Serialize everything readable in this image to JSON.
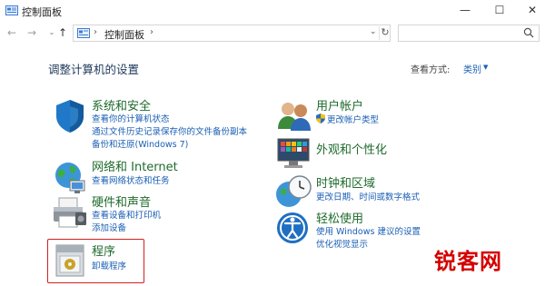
{
  "window": {
    "title": "控制面板",
    "minimize_glyph": "—",
    "maximize_glyph": "☐",
    "close_glyph": "✕"
  },
  "nav": {
    "back_icon": "arrow-left-icon",
    "forward_icon": "arrow-right-icon",
    "up_icon": "arrow-up-icon",
    "address_sep": "›",
    "address_text": "控制面板",
    "address_sep2": "›",
    "refresh_glyph": "↻",
    "dropdown_glyph": "⌄",
    "search_placeholder": ""
  },
  "main": {
    "heading": "调整计算机的设置",
    "view_by_label": "查看方式:",
    "view_by_value": "类别",
    "view_by_arrow": "▼"
  },
  "categories_left": [
    {
      "title": "系统和安全",
      "links": [
        "查看你的计算机状态",
        "通过文件历史记录保存你的文件备份副本",
        "备份和还原(Windows 7)"
      ]
    },
    {
      "title": "网络和 Internet",
      "links": [
        "查看网络状态和任务"
      ]
    },
    {
      "title": "硬件和声音",
      "links": [
        "查看设备和打印机",
        "添加设备"
      ]
    },
    {
      "title": "程序",
      "links": [
        "卸载程序"
      ]
    }
  ],
  "categories_right": [
    {
      "title": "用户帐户",
      "links": [
        "更改帐户类型"
      ]
    },
    {
      "title": "外观和个性化",
      "links": []
    },
    {
      "title": "时钟和区域",
      "links": [
        "更改日期、时间或数字格式"
      ]
    },
    {
      "title": "轻松使用",
      "links": [
        "使用 Windows 建议的设置",
        "优化视觉显示"
      ]
    }
  ],
  "watermark": "锐客网",
  "colors": {
    "heading": "#1f3a5c",
    "category_title": "#1e6b2c",
    "link": "#1a5fb4",
    "highlight": "#d21e1e",
    "watermark": "#d40000"
  }
}
